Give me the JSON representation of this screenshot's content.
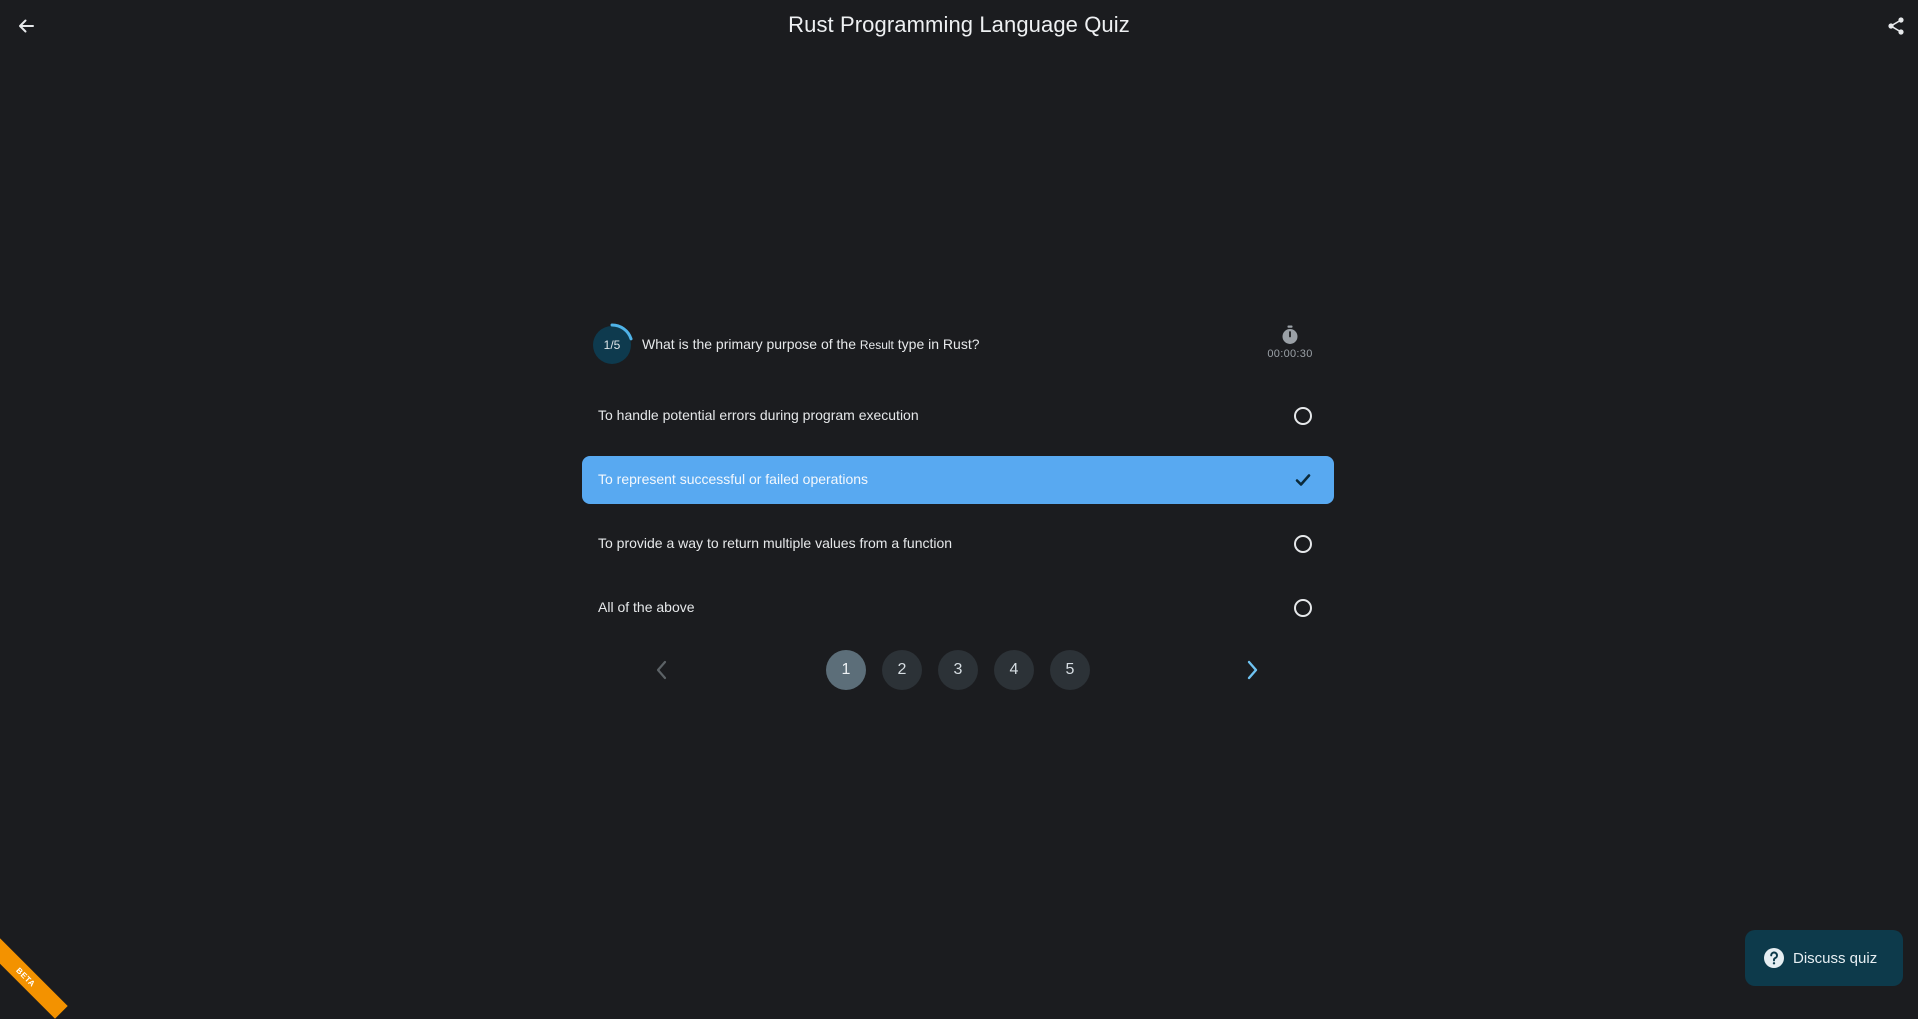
{
  "header": {
    "title": "Rust Programming Language Quiz",
    "back_icon": "arrow-left-icon",
    "share_icon": "share-icon"
  },
  "question": {
    "progress_label": "1/5",
    "progress_fraction": 0.2,
    "text_before": "What is the primary purpose of the ",
    "code": "Result",
    "text_after": " type in Rust?",
    "timer": "00:00:30"
  },
  "options": [
    {
      "label": "To handle potential errors during program execution",
      "selected": false
    },
    {
      "label": "To represent successful or failed operations",
      "selected": true
    },
    {
      "label": "To provide a way to return multiple values from a function",
      "selected": false
    },
    {
      "label": "All of the above",
      "selected": false
    }
  ],
  "pagination": {
    "pages": [
      "1",
      "2",
      "3",
      "4",
      "5"
    ],
    "current": "1"
  },
  "discuss": {
    "label": "Discuss quiz"
  },
  "beta": {
    "label": "BETA"
  },
  "colors": {
    "background": "#1b1c1f",
    "selected_option": "#58a9f1",
    "progress_arc": "#4fb3e8",
    "discuss_bg": "#0d3a4b",
    "beta_ribbon": "#f39200"
  }
}
